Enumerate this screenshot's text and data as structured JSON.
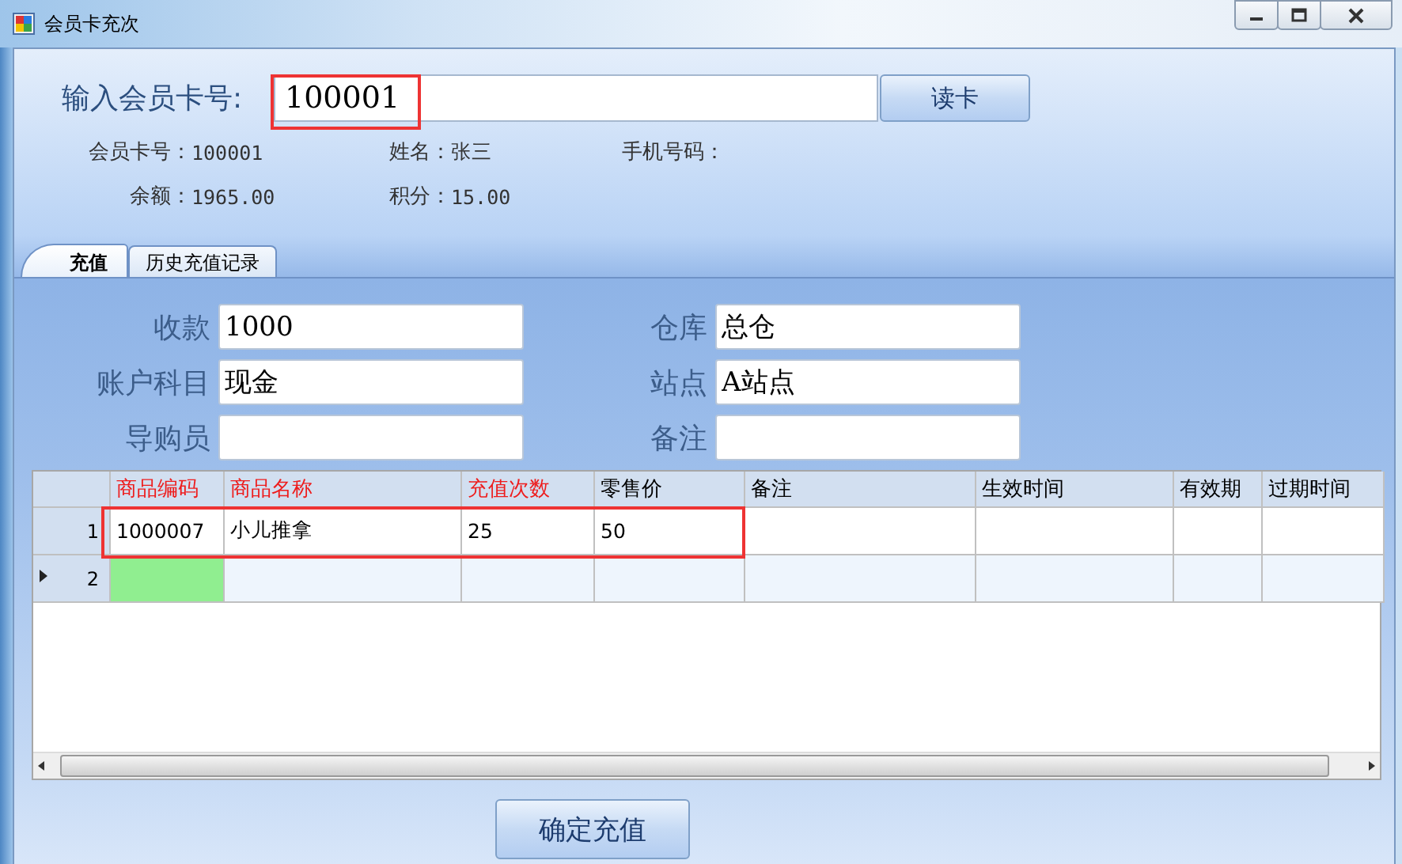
{
  "window": {
    "title": "会员卡充次"
  },
  "card_input": {
    "label": "输入会员卡号:",
    "value": "100001"
  },
  "read_button": "读卡",
  "info_rows": [
    [
      {
        "label": "会员卡号：",
        "value": "100001"
      },
      {
        "label": "姓名：",
        "value": "张三"
      },
      {
        "label": "手机号码："
      }
    ],
    [
      {
        "label": "余额：",
        "value": "1965.00"
      },
      {
        "label": "积分：",
        "value": "15.00"
      }
    ]
  ],
  "tabs": [
    {
      "label": "充值",
      "selected": true
    },
    {
      "label": "历史充值记录",
      "selected": false
    }
  ],
  "form_rows": [
    [
      {
        "label": "收款",
        "value": "1000"
      },
      {
        "label": "仓库",
        "value": "总仓"
      }
    ],
    [
      {
        "label": "账户科目",
        "value": "现金"
      },
      {
        "label": "站点",
        "value": "A站点"
      }
    ],
    [
      {
        "label": "导购员"
      },
      {
        "label": "备注"
      }
    ]
  ],
  "grid": {
    "columns": [
      {
        "label": "商品编码",
        "required": true
      },
      {
        "label": "商品名称",
        "required": true
      },
      {
        "label": "充值次数",
        "required": true
      },
      {
        "label": "零售价",
        "required": false
      },
      {
        "label": "备注",
        "required": false
      },
      {
        "label": "生效时间",
        "required": false
      },
      {
        "label": "有效期",
        "required": false
      },
      {
        "label": "过期时间",
        "required": false
      }
    ],
    "rows": [
      {
        "number": "1",
        "current": false,
        "cells": [
          "1000007",
          "小儿推拿",
          "25",
          "50"
        ]
      },
      {
        "number": "2",
        "current": true
      }
    ]
  },
  "confirm_button": "确定充值"
}
